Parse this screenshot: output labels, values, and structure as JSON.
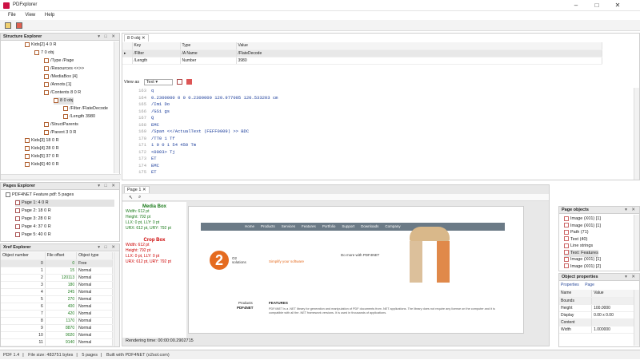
{
  "app": {
    "title": "PDFxplorer"
  },
  "menu": [
    "File",
    "View",
    "Help"
  ],
  "structure": {
    "title": "Structure Explorer",
    "items": [
      {
        "label": "Kids[2] 4 0 R",
        "indent": 30
      },
      {
        "label": "7 0 obj",
        "indent": 42
      },
      {
        "label": "/Type /Page",
        "indent": 54
      },
      {
        "label": "/Resources <<>>",
        "indent": 54
      },
      {
        "label": "/MediaBox [4]",
        "indent": 54
      },
      {
        "label": "/Annots [1]",
        "indent": 54
      },
      {
        "label": "/Contents 8 0 R",
        "indent": 54
      },
      {
        "label": "8 0 obj",
        "indent": 66
      },
      {
        "label": "/Filter /FlateDecode",
        "indent": 78
      },
      {
        "label": "/Length 3980",
        "indent": 78
      },
      {
        "label": "/StructParents",
        "indent": 54
      },
      {
        "label": "/Parent 3 0 R",
        "indent": 54
      },
      {
        "label": "Kids[3] 18 0 R",
        "indent": 30
      },
      {
        "label": "Kids[4] 28 0 R",
        "indent": 30
      },
      {
        "label": "Kids[5] 37 0 R",
        "indent": 30
      },
      {
        "label": "Kids[6] 40 0 R",
        "indent": 30
      }
    ]
  },
  "objtab": {
    "label": "8 0 obj"
  },
  "dict": {
    "headers": [
      "Key",
      "Type",
      "Value"
    ],
    "rows": [
      [
        "/Filter",
        "/A Name",
        "/FlateDecode"
      ],
      [
        "/Length",
        "Number",
        "3980"
      ]
    ]
  },
  "viewas": {
    "label": "View as",
    "value": "Text"
  },
  "code": {
    "lines": [
      {
        "n": "163",
        "t": "q"
      },
      {
        "n": "164",
        "t": "0.2300000 0 0 0.2300000 120.977005 120.533203 cm"
      },
      {
        "n": "165",
        "t": "/Im1 Do"
      },
      {
        "n": "166",
        "t": "/GS1 gs"
      },
      {
        "n": "167",
        "t": "Q"
      },
      {
        "n": "168",
        "t": "EMC"
      },
      {
        "n": "169",
        "t": "/Span <</ActualText (FEFF0009) >> BDC"
      },
      {
        "n": "170",
        "t": "/TT0 1 Tf"
      },
      {
        "n": "171",
        "t": "1 0 0 1 54 450 Tm"
      },
      {
        "n": "172",
        "t": "<0003> Tj"
      },
      {
        "n": "173",
        "t": "ET"
      },
      {
        "n": "174",
        "t": "EMC"
      },
      {
        "n": "175",
        "t": "ET"
      }
    ]
  },
  "pages": {
    "title": "Pages Explorer",
    "root": "PDF4NET Feature.pdf: 5 pages",
    "items": [
      "Page 1: 4 0 R",
      "Page 2: 18 0 R",
      "Page 3: 28 0 R",
      "Page 4: 37 0 R",
      "Page 5: 40 0 R"
    ]
  },
  "xref": {
    "title": "Xref Explorer",
    "headers": [
      "Object number",
      "File offset",
      "Object type"
    ],
    "rows": [
      [
        "0",
        "0",
        "Free"
      ],
      [
        "1",
        "15",
        "Normal"
      ],
      [
        "2",
        "120113",
        "Normal"
      ],
      [
        "3",
        "180",
        "Normal"
      ],
      [
        "4",
        "245",
        "Normal"
      ],
      [
        "5",
        "270",
        "Normal"
      ],
      [
        "6",
        "400",
        "Normal"
      ],
      [
        "7",
        "420",
        "Normal"
      ],
      [
        "8",
        "1170",
        "Normal"
      ],
      [
        "9",
        "8870",
        "Normal"
      ],
      [
        "10",
        "9020",
        "Normal"
      ],
      [
        "11",
        "9140",
        "Normal"
      ]
    ]
  },
  "pagetab": {
    "label": "Page 1"
  },
  "mediabox": {
    "title": "Media Box",
    "lines": [
      "Width: 612 pt",
      "Height: 792 pt",
      "LLX: 0 pt, LLY: 0 pt",
      "URX: 612 pt, URY: 792 pt"
    ]
  },
  "cropbox": {
    "title": "Crop Box",
    "lines": [
      "Width: 612 pt",
      "Height: 792 pt",
      "LLX: 0 pt, LLY: 0 pt",
      "URX: 612 pt, URY: 792 pt"
    ]
  },
  "pagepreview": {
    "nav": [
      "Home",
      "Products",
      "Services",
      "Features",
      "Portfolio",
      "Support",
      "Downloads",
      "Company"
    ],
    "logo_num": "2",
    "logo_txt": "O2 solutions",
    "tagline": "Simplify your software",
    "headline": "Do more with PDF4NET",
    "products_title": "Products",
    "products_name": "PDF4NET",
    "features_title": "FEATURES",
    "body": "PDF4NET is a .NET library for generation and manipulation of PDF documents from .NET applications. The library does not require any license on the computer and it is compatible with all the .NET framework versions. It is used in thousands of applications."
  },
  "rendering": {
    "text": "Rendering time: 00:00:00.2902715"
  },
  "pageobjects": {
    "title": "Page objects",
    "items": [
      "Image (X01) [1]",
      "Image (X01) [1]",
      "Path (71)",
      "Text (40)",
      "Line strings",
      "Text: Features",
      "Image (X01) [1]",
      "Image (X01) [2]"
    ]
  },
  "objprops": {
    "title": "Object properties",
    "tabs": [
      "Properties",
      "Page"
    ],
    "headers": [
      "Name",
      "Value"
    ],
    "rows": [
      [
        "Bounds",
        ""
      ],
      [
        "Height",
        "",
        "100.0000"
      ],
      [
        "Display",
        "",
        "0.00 x 0.00"
      ],
      [
        "Content",
        ""
      ],
      [
        "Width",
        "",
        "1.000000"
      ]
    ]
  },
  "status": [
    "PDF 1.4",
    "File size: 483751 bytes",
    "5 pages",
    "Built with PDF4NET (o2sol.com)"
  ]
}
